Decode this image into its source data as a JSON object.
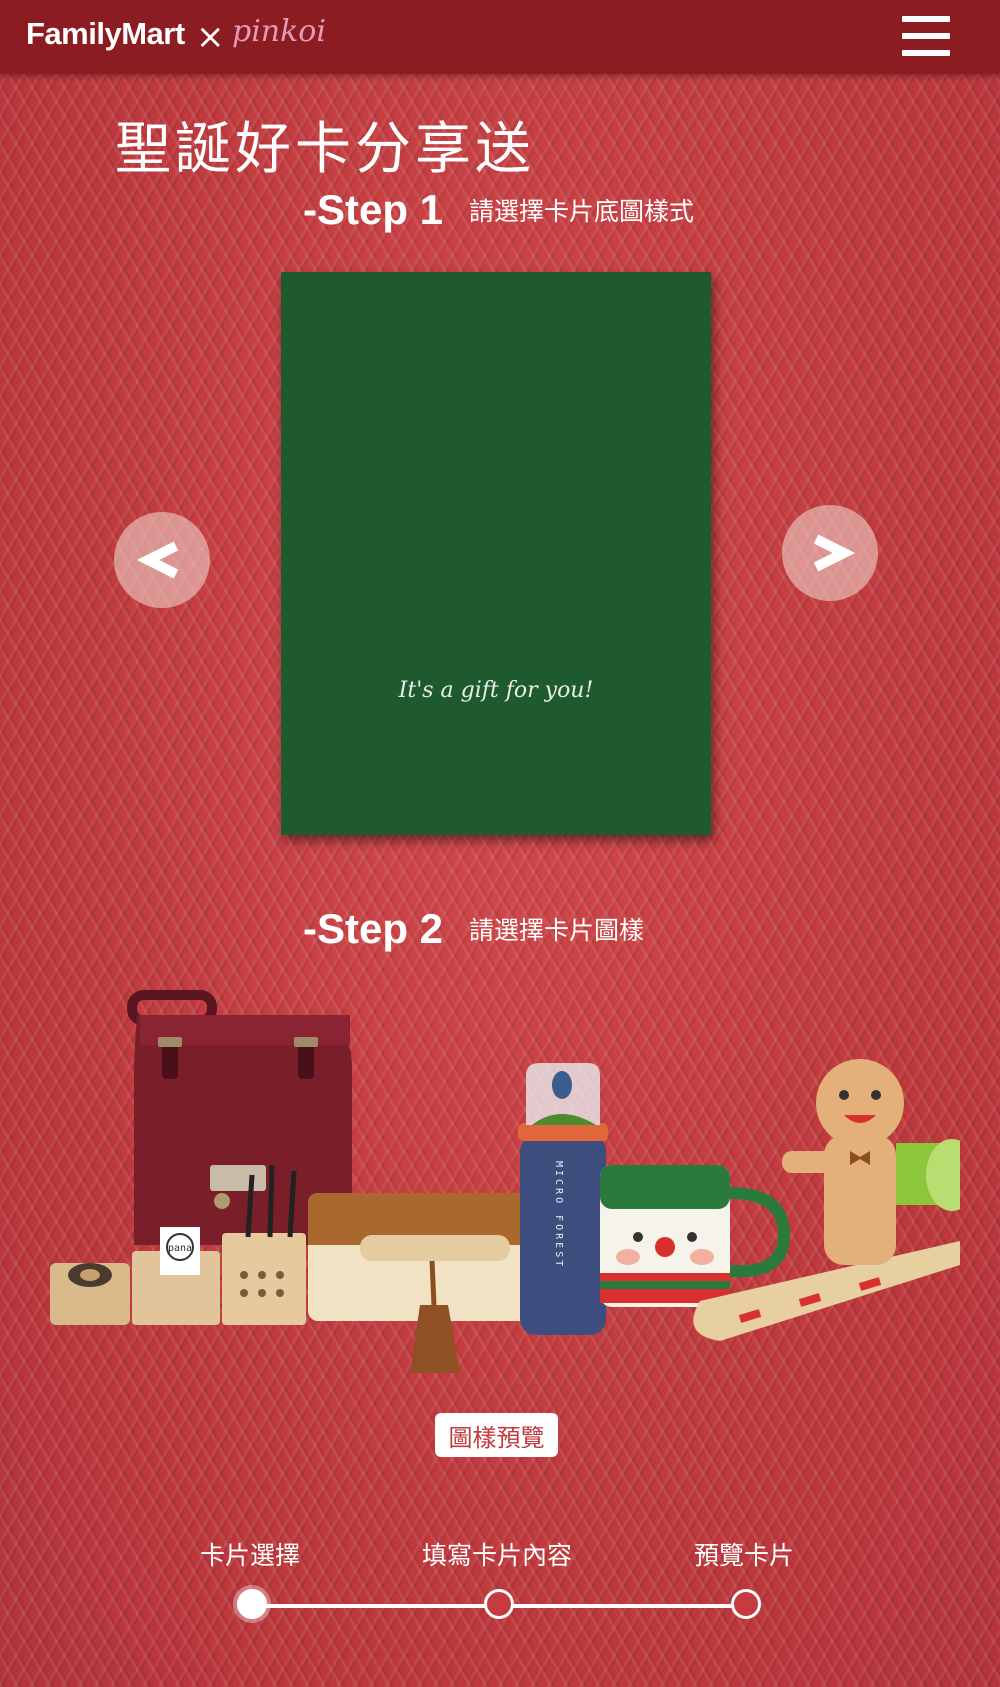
{
  "header": {
    "brand_left": "FamilyMart",
    "brand_separator": "×",
    "brand_right": "pinkoi",
    "menu_icon": "hamburger-menu-icon"
  },
  "page": {
    "title": "聖誕好卡分享送"
  },
  "step1": {
    "label": "-Step 1",
    "description": "請選擇卡片底圖樣式",
    "card_color": "#1f5a2f",
    "card_text": "It's a gift for you!",
    "prev_label": "<",
    "next_label": ">"
  },
  "step2": {
    "label": "-Step 2",
    "description": "請選擇卡片圖樣",
    "items": [
      "backpack",
      "wooden-desk-organizer",
      "leather-pencil-case",
      "micro-forest-bottle",
      "snowman-mug",
      "gingerbread-cup-holder"
    ],
    "bottle_text": "MICRO FOREST",
    "organizer_text": "pana",
    "preview_button": "圖樣預覽"
  },
  "progress": {
    "steps": [
      {
        "label": "卡片選擇",
        "active": true
      },
      {
        "label": "填寫卡片內容",
        "active": false
      },
      {
        "label": "預覽卡片",
        "active": false
      }
    ]
  },
  "colors": {
    "header_bg": "#8b1c22",
    "background": "#c53b3f",
    "accent_text": "#c0393d"
  }
}
